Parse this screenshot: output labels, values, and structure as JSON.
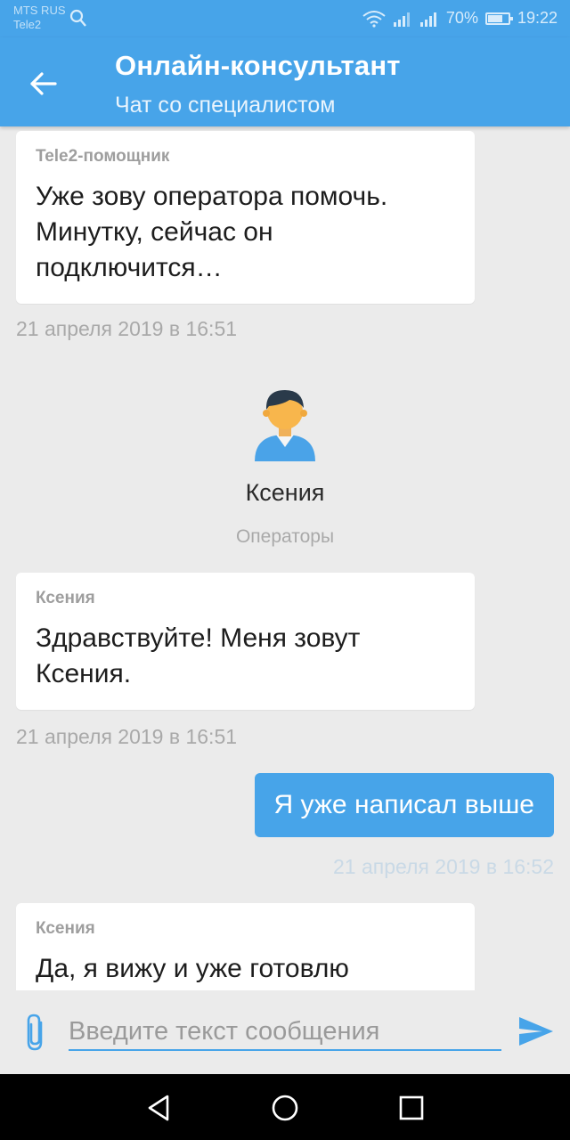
{
  "status_bar": {
    "carrier_1": "MTS RUS",
    "carrier_2": "Tele2",
    "battery": "70%",
    "time": "19:22"
  },
  "header": {
    "title": "Онлайн-консультант",
    "subtitle": "Чат со специалистом"
  },
  "messages": [
    {
      "author": "Tele2-помощник",
      "text": "Уже зову оператора помочь. Минутку, сейчас он подключится…",
      "time": "21 апреля 2019 в 16:51"
    },
    {
      "author": "Ксения",
      "text": "Здравствуйте! Меня зовут Ксения.",
      "time": "21 апреля 2019 в 16:51"
    },
    {
      "text": "Я уже написал выше",
      "time": "21 апреля 2019 в 16:52"
    },
    {
      "author": "Ксения",
      "text": "Да, я вижу и уже готовлю"
    }
  ],
  "operator": {
    "name": "Ксения",
    "role": "Операторы"
  },
  "input": {
    "placeholder": "Введите текст сообщения"
  },
  "colors": {
    "accent": "#47a4e9",
    "background": "#ebebeb"
  },
  "icons": {
    "back": "arrow-left-icon",
    "attach": "paperclip-icon",
    "send": "send-icon",
    "nav_back": "triangle-back-icon",
    "nav_home": "circle-home-icon",
    "nav_recent": "square-recent-icon"
  }
}
